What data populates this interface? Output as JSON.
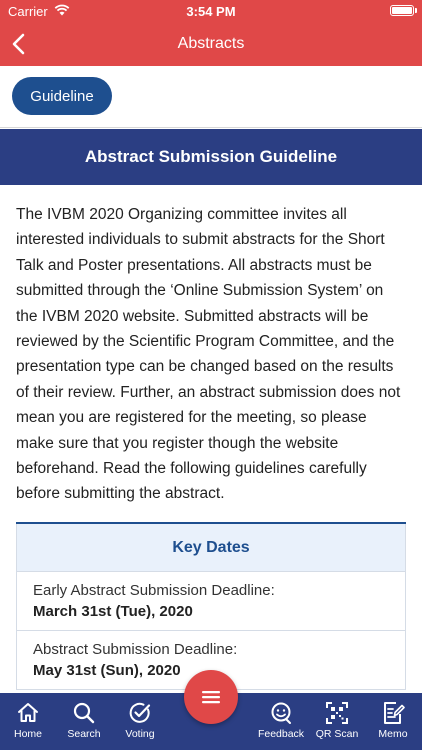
{
  "status_bar": {
    "carrier": "Carrier",
    "time": "3:54 PM"
  },
  "nav": {
    "title": "Abstracts"
  },
  "tabs": {
    "guideline_label": "Guideline"
  },
  "section": {
    "title": "Abstract Submission Guideline"
  },
  "body": {
    "paragraph": "The IVBM 2020 Organizing committee invites all interested individuals to submit abstracts for the Short Talk and Poster presentations. All abstracts must be submitted through the ‘Online Submission System’ on the IVBM 2020 website. Submitted abstracts will be reviewed by the Scientific Program Committee, and the presentation type can be changed based on the results of their review. Further, an abstract submission does not mean you are registered for the meeting, so please make sure that you register though the website beforehand. Read the following guidelines carefully before submitting the abstract."
  },
  "key_dates": {
    "title": "Key Dates",
    "rows": [
      {
        "label": "Early Abstract Submission Deadline:",
        "value": "March 31st (Tue), 2020"
      },
      {
        "label": "Abstract Submission Deadline:",
        "value": "May 31st (Sun), 2020"
      }
    ]
  },
  "tab_bar": {
    "items": [
      {
        "label": "Home",
        "icon": "home-icon"
      },
      {
        "label": "Search",
        "icon": "search-icon"
      },
      {
        "label": "Voting",
        "icon": "voting-icon"
      },
      {
        "label": "Feedback",
        "icon": "feedback-icon"
      },
      {
        "label": "QR Scan",
        "icon": "qr-scan-icon"
      },
      {
        "label": "Memo",
        "icon": "memo-icon"
      }
    ]
  },
  "colors": {
    "nav_red": "#e04848",
    "navy": "#2b3e83",
    "button_blue": "#1e4f8f",
    "key_dates_bg": "#e9f1fb"
  }
}
